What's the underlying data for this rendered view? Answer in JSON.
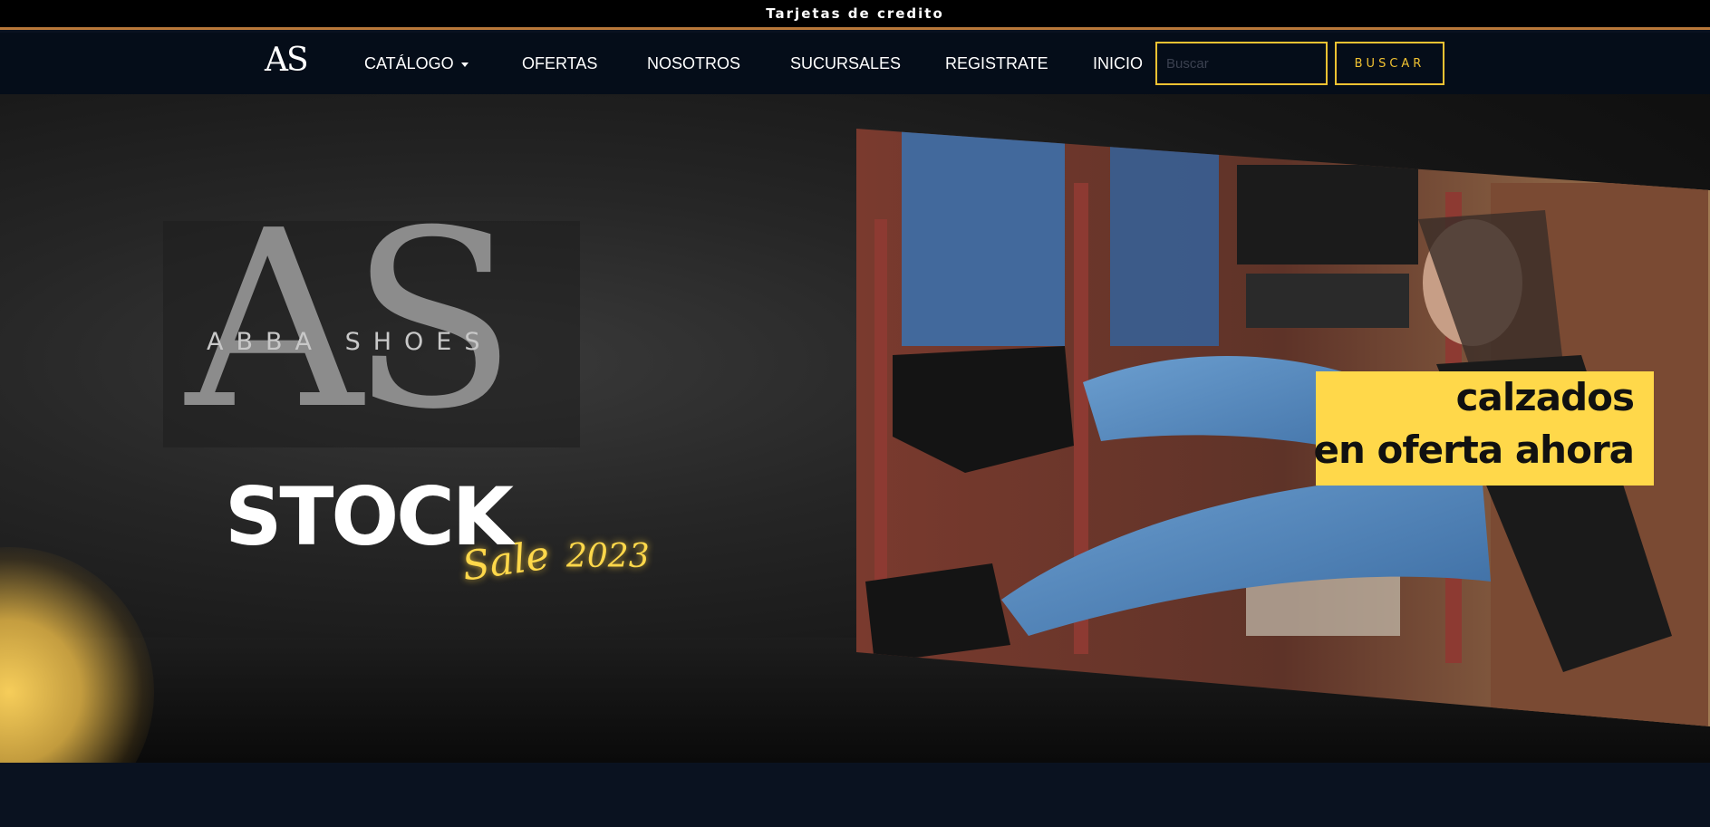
{
  "topbar": {
    "text": "Tarjetas de credito"
  },
  "navbar": {
    "logo": "AS",
    "items": [
      {
        "label": "CATÁLOGO",
        "dropdown": true
      },
      {
        "label": "OFERTAS"
      },
      {
        "label": "NOSOTROS"
      },
      {
        "label": "SUCURSALES"
      },
      {
        "label": "REGISTRATE"
      },
      {
        "label": "INICIO"
      }
    ],
    "search": {
      "placeholder": "Buscar",
      "value": ""
    },
    "search_button": "BUSCAR"
  },
  "hero": {
    "brand_mono": "AS",
    "brand_name": "ABBA SHOES",
    "stock_title": "STOCK",
    "sale_text": "Sale",
    "sale_year": "2023",
    "promo_line1": "calzados",
    "promo_line2": "en oferta ahora"
  },
  "colors": {
    "accent": "#f1c232",
    "topbar_border": "#b8783a",
    "navbar_bg": "#050d19",
    "promo_bg": "#ffd84a"
  }
}
